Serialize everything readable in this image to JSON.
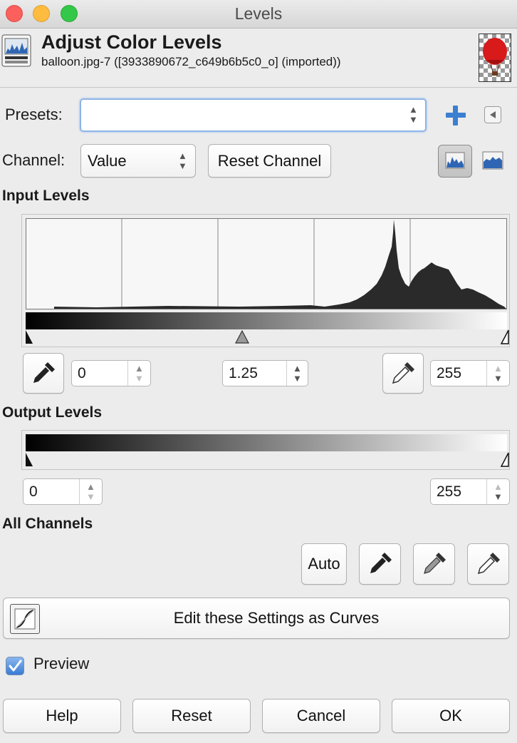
{
  "window": {
    "title": "Levels"
  },
  "header": {
    "title": "Adjust Color Levels",
    "subtitle": "balloon.jpg-7 ([3933890672_c649b6b5c0_o] (imported))",
    "icon": "levels-icon",
    "thumbnail": "balloon-thumbnail"
  },
  "presets": {
    "label": "Presets:",
    "value": ""
  },
  "channel": {
    "label": "Channel:",
    "value": "Value",
    "reset_label": "Reset Channel"
  },
  "input_levels": {
    "heading": "Input Levels",
    "black_value": "0",
    "gamma_value": "1.25",
    "white_value": "255"
  },
  "output_levels": {
    "heading": "Output Levels",
    "low_value": "0",
    "high_value": "255"
  },
  "all_channels": {
    "heading": "All Channels",
    "auto_label": "Auto"
  },
  "curves_button": {
    "label": "Edit these Settings as Curves"
  },
  "preview": {
    "label": "Preview",
    "checked": true
  },
  "footer": {
    "help": "Help",
    "reset": "Reset",
    "cancel": "Cancel",
    "ok": "OK"
  },
  "colors": {
    "accent": "#3b7fd1",
    "histogram": "#2a2a2a",
    "close": "#fc605c",
    "minimize": "#fdbc40",
    "zoom": "#34c84a"
  }
}
